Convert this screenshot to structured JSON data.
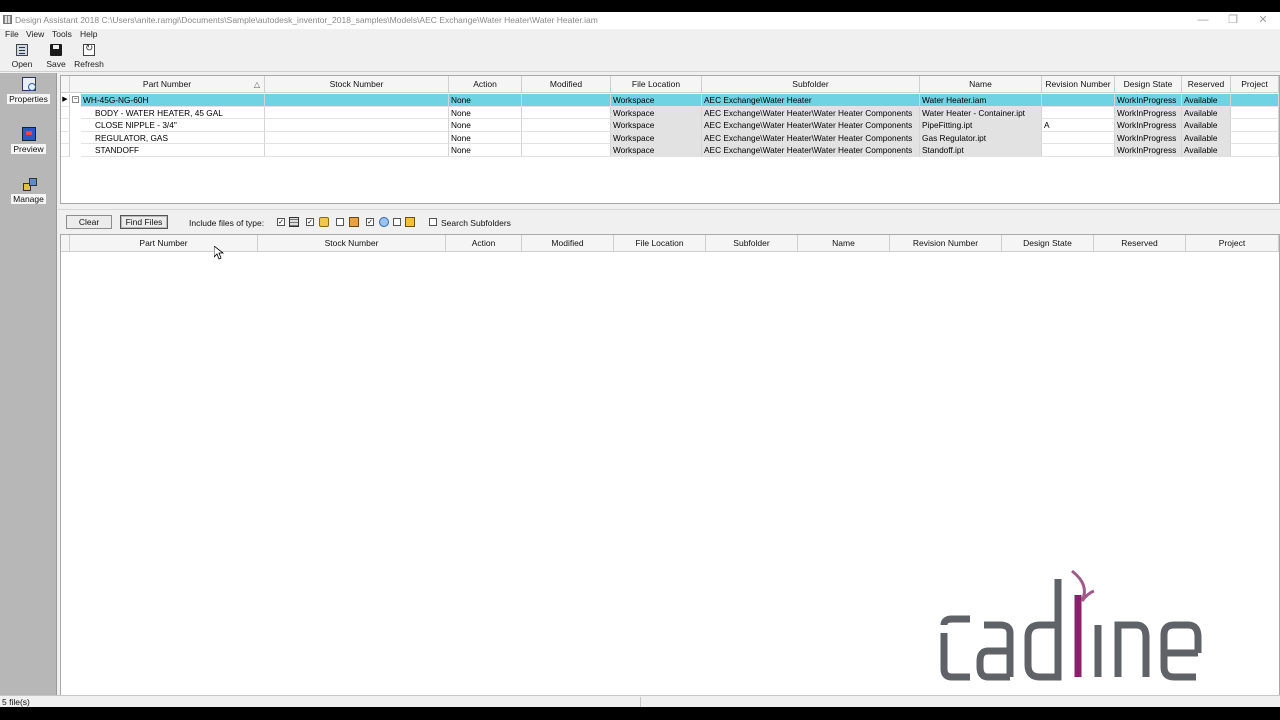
{
  "window": {
    "title": "Design Assistant 2018 C:\\Users\\anite.ramgi\\Documents\\Sample\\autodesk_inventor_2018_samples\\Models\\AEC Exchange\\Water Heater\\Water Heater.iam",
    "minimize": "—",
    "restore": "❐",
    "close": "✕"
  },
  "menu": [
    "File",
    "View",
    "Tools",
    "Help"
  ],
  "toolbar": {
    "open": "Open",
    "save": "Save",
    "refresh": "Refresh"
  },
  "sidebar": {
    "properties": "Properties",
    "preview": "Preview",
    "manage": "Manage"
  },
  "top_grid": {
    "columns": [
      "Part Number",
      "Stock Number",
      "Action",
      "Modified",
      "File Location",
      "Subfolder",
      "Name",
      "Revision Number",
      "Design State",
      "Reserved",
      "Project"
    ],
    "sort_arrow": "△",
    "row_marker": "▶",
    "collapse_toggle": "−",
    "rows": [
      {
        "part": "WH-45G-NG-60H",
        "stock": "",
        "action": "None",
        "modified": "",
        "location": "Workspace",
        "subfolder": "AEC Exchange\\Water Heater",
        "name": "Water Heater.iam",
        "revision": "",
        "state": "WorkInProgress",
        "reserved": "Available",
        "project": ""
      },
      {
        "part": "BODY - WATER HEATER, 45 GAL",
        "stock": "",
        "action": "None",
        "modified": "",
        "location": "Workspace",
        "subfolder": "AEC Exchange\\Water Heater\\Water Heater Components",
        "name": "Water Heater - Container.ipt",
        "revision": "",
        "state": "WorkInProgress",
        "reserved": "Available",
        "project": ""
      },
      {
        "part": "CLOSE NIPPLE - 3/4\"",
        "stock": "",
        "action": "None",
        "modified": "",
        "location": "Workspace",
        "subfolder": "AEC Exchange\\Water Heater\\Water Heater Components",
        "name": "PipeFitting.ipt",
        "revision": "A",
        "state": "WorkInProgress",
        "reserved": "Available",
        "project": ""
      },
      {
        "part": "REGULATOR, GAS",
        "stock": "",
        "action": "None",
        "modified": "",
        "location": "Workspace",
        "subfolder": "AEC Exchange\\Water Heater\\Water Heater Components",
        "name": "Gas Regulator.ipt",
        "revision": "",
        "state": "WorkInProgress",
        "reserved": "Available",
        "project": ""
      },
      {
        "part": "STANDOFF",
        "stock": "",
        "action": "None",
        "modified": "",
        "location": "Workspace",
        "subfolder": "AEC Exchange\\Water Heater\\Water Heater Components",
        "name": "Standoff.ipt",
        "revision": "",
        "state": "WorkInProgress",
        "reserved": "Available",
        "project": ""
      }
    ]
  },
  "find_bar": {
    "clear": "Clear",
    "find": "Find Files",
    "include_label": "Include files of type:",
    "check_mark": "✓",
    "search_subfolders": "Search Subfolders"
  },
  "bottom_grid": {
    "columns": [
      "Part Number",
      "Stock Number",
      "Action",
      "Modified",
      "File Location",
      "Subfolder",
      "Name",
      "Revision Number",
      "Design State",
      "Reserved",
      "Project"
    ]
  },
  "status": {
    "files": "5 file(s)"
  },
  "logo": {
    "text": "cadline"
  },
  "colors": {
    "selection": "#6fd3e3",
    "sidebar": "#b7b7b7",
    "logo_gray": "#5f6368",
    "logo_accent": "#8a1f6b"
  }
}
